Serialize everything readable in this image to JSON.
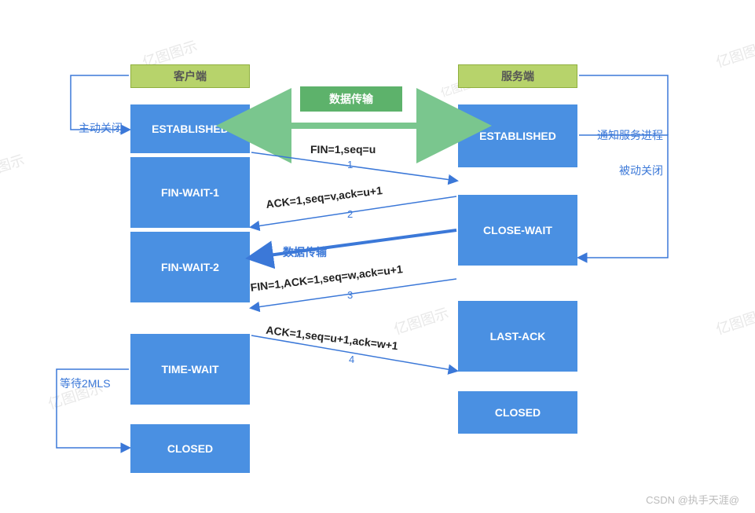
{
  "headers": {
    "client": "客户端",
    "server": "服务端",
    "data_transfer": "数据传输"
  },
  "client_states": {
    "established": "ESTABLISHED",
    "fin_wait_1": "FIN-WAIT-1",
    "fin_wait_2": "FIN-WAIT-2",
    "time_wait": "TIME-WAIT",
    "closed": "CLOSED"
  },
  "server_states": {
    "established": "ESTABLISHED",
    "close_wait": "CLOSE-WAIT",
    "last_ack": "LAST-ACK",
    "closed": "CLOSED"
  },
  "side_labels": {
    "active_close": "主动关闭",
    "notify_process": "通知服务进程",
    "passive_close": "被动关闭",
    "wait_2mls": "等待2MLS",
    "data_transfer_mid": "数据传输"
  },
  "messages": {
    "m1": "FIN=1,seq=u",
    "m2": "ACK=1,seq=v,ack=u+1",
    "m3": "FIN=1,ACK=1,seq=w,ack=u+1",
    "m4": "ACK=1,seq=u+1,ack=w+1"
  },
  "seq_nums": {
    "n1": "1",
    "n2": "2",
    "n3": "3",
    "n4": "4"
  },
  "footer": "CSDN @执手天涯@",
  "watermark": "亿图图示",
  "colors": {
    "blue": "#4a90e2",
    "green_header": "#b7d36b",
    "green_title": "#5db26b",
    "arrow_blue": "#3b78d8",
    "green_arrow": "#7ac68e"
  }
}
